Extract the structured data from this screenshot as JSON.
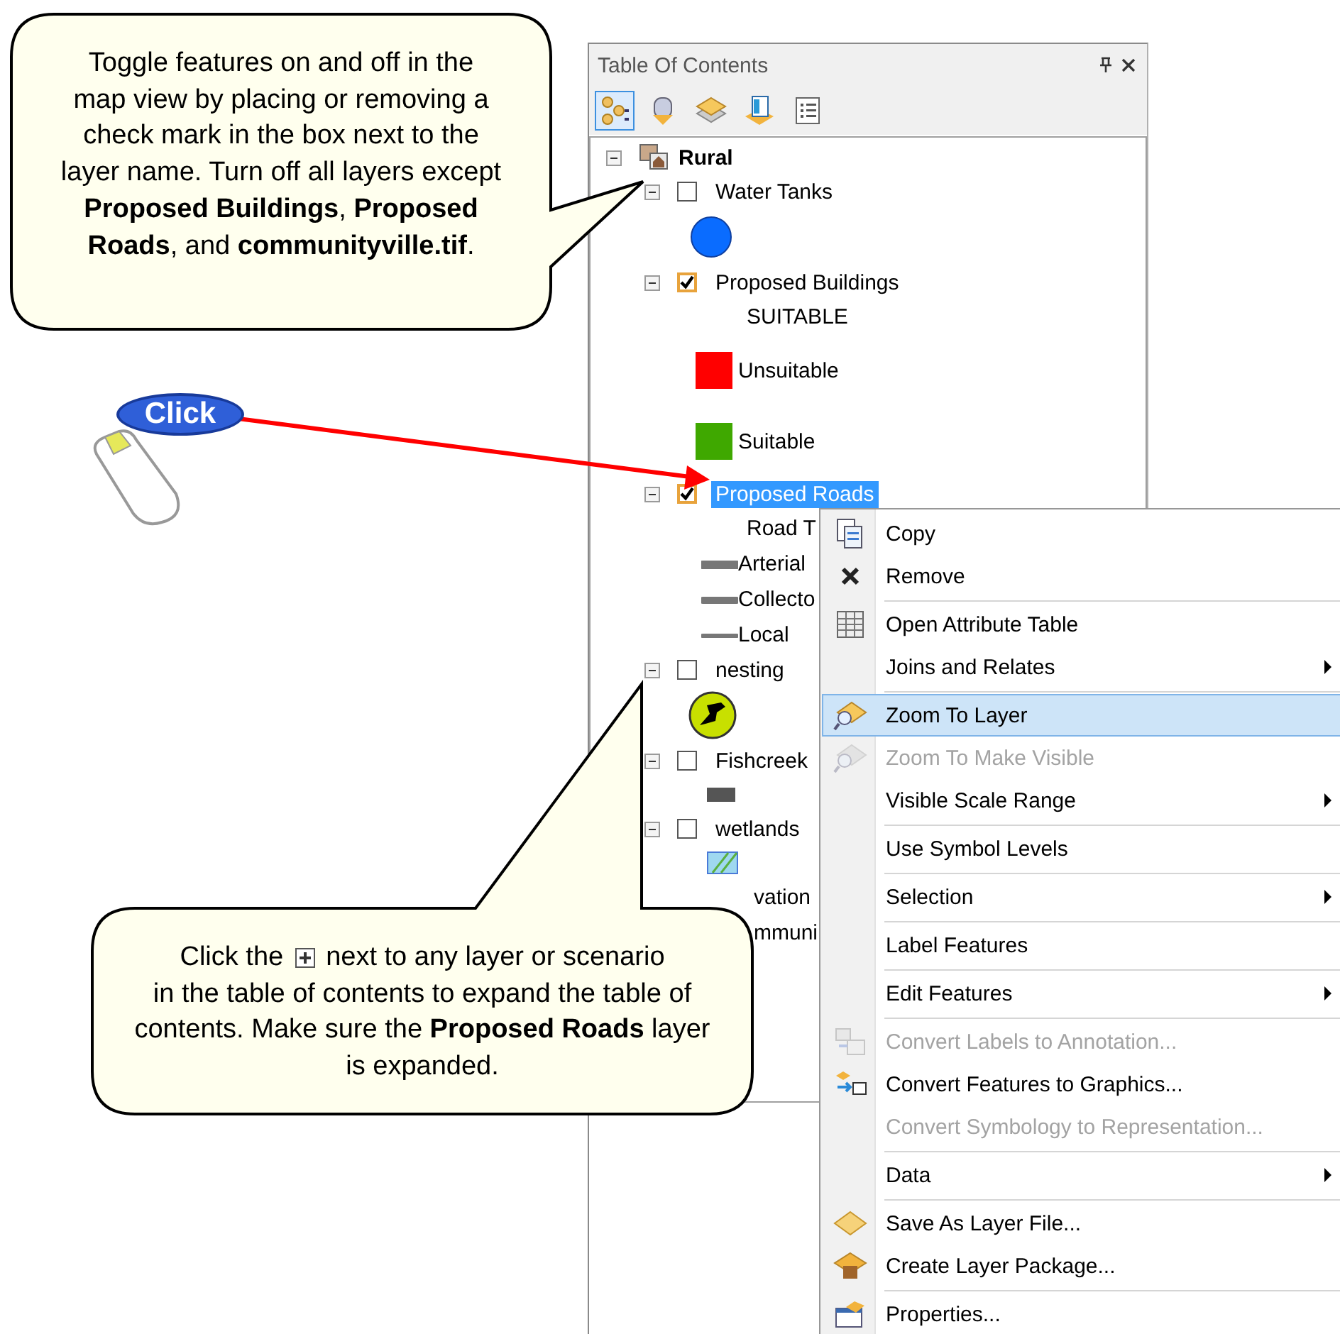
{
  "panel": {
    "title": "Table Of Contents",
    "toolbar": [
      {
        "kind": "drawing-order",
        "selected": true
      },
      {
        "kind": "source",
        "selected": false
      },
      {
        "kind": "visibility",
        "selected": false
      },
      {
        "kind": "selection",
        "selected": false
      },
      {
        "kind": "options",
        "selected": false
      }
    ]
  },
  "tree": {
    "name": "Rural",
    "expanded": true,
    "children": [
      {
        "kind": "layer",
        "name": "Water Tanks",
        "checked": false,
        "selected": false,
        "expanded": true,
        "legend": [
          {
            "kind": "circle",
            "color": "#0a6cff"
          }
        ]
      },
      {
        "kind": "layer",
        "name": "Proposed Buildings",
        "checked": true,
        "selected": false,
        "expanded": true,
        "legend": [
          {
            "kind": "heading",
            "label": "SUITABLE"
          },
          {
            "kind": "fill",
            "color": "#ff0000",
            "label": "Unsuitable"
          },
          {
            "kind": "fill",
            "color": "#3fa800",
            "label": "Suitable"
          }
        ]
      },
      {
        "kind": "layer",
        "name": "Proposed Roads",
        "checked": true,
        "selected": true,
        "expanded": true,
        "legend": [
          {
            "kind": "heading",
            "label": "Road T"
          },
          {
            "kind": "thickline",
            "label": "Arterial"
          },
          {
            "kind": "line",
            "label": "Collecto"
          },
          {
            "kind": "thinline",
            "label": "Local"
          }
        ]
      },
      {
        "kind": "layer",
        "name": "nesting",
        "checked": false,
        "selected": false,
        "expanded": true,
        "legend": [
          {
            "kind": "bird",
            "color": "#c8e000"
          }
        ]
      },
      {
        "kind": "layer",
        "name": "Fishcreek",
        "checked": false,
        "selected": false,
        "expanded": true,
        "legend": [
          {
            "kind": "bar",
            "color": "#555555"
          }
        ]
      },
      {
        "kind": "layer",
        "name": "wetlands",
        "checked": false,
        "selected": false,
        "expanded": true,
        "legend": [
          {
            "kind": "hatch",
            "color": "#9fd8f0"
          }
        ]
      },
      {
        "kind": "fragment",
        "name": "vation"
      },
      {
        "kind": "fragment",
        "name": "mmuni"
      }
    ]
  },
  "context_menu": [
    {
      "kind": "item",
      "label": "Copy",
      "disabled": false,
      "selected": false,
      "submenu": false
    },
    {
      "kind": "item",
      "label": "Remove",
      "disabled": false,
      "selected": false,
      "submenu": false
    },
    {
      "kind": "separator"
    },
    {
      "kind": "item",
      "label": "Open Attribute Table",
      "disabled": false,
      "selected": false,
      "submenu": false
    },
    {
      "kind": "item",
      "label": "Joins and Relates",
      "disabled": false,
      "selected": false,
      "submenu": true
    },
    {
      "kind": "separator"
    },
    {
      "kind": "item",
      "label": "Zoom To Layer",
      "disabled": false,
      "selected": true,
      "submenu": false
    },
    {
      "kind": "item",
      "label": "Zoom To Make Visible",
      "disabled": true,
      "selected": false,
      "submenu": false
    },
    {
      "kind": "item",
      "label": "Visible Scale Range",
      "disabled": false,
      "selected": false,
      "submenu": true
    },
    {
      "kind": "separator"
    },
    {
      "kind": "item",
      "label": "Use Symbol Levels",
      "disabled": false,
      "selected": false,
      "submenu": false
    },
    {
      "kind": "separator"
    },
    {
      "kind": "item",
      "label": "Selection",
      "disabled": false,
      "selected": false,
      "submenu": true
    },
    {
      "kind": "separator"
    },
    {
      "kind": "item",
      "label": "Label Features",
      "disabled": false,
      "selected": false,
      "submenu": false
    },
    {
      "kind": "separator"
    },
    {
      "kind": "item",
      "label": "Edit Features",
      "disabled": false,
      "selected": false,
      "submenu": true
    },
    {
      "kind": "separator"
    },
    {
      "kind": "item",
      "label": "Convert Labels to Annotation...",
      "disabled": true,
      "selected": false,
      "submenu": false
    },
    {
      "kind": "item",
      "label": "Convert Features to Graphics...",
      "disabled": false,
      "selected": false,
      "submenu": false
    },
    {
      "kind": "item",
      "label": "Convert Symbology to Representation...",
      "disabled": true,
      "selected": false,
      "submenu": false
    },
    {
      "kind": "separator"
    },
    {
      "kind": "item",
      "label": "Data",
      "disabled": false,
      "selected": false,
      "submenu": true
    },
    {
      "kind": "separator"
    },
    {
      "kind": "item",
      "label": "Save As Layer File...",
      "disabled": false,
      "selected": false,
      "submenu": false
    },
    {
      "kind": "item",
      "label": "Create Layer Package...",
      "disabled": false,
      "selected": false,
      "submenu": false
    },
    {
      "kind": "separator"
    },
    {
      "kind": "item",
      "label": "Properties...",
      "disabled": false,
      "selected": false,
      "submenu": false
    }
  ],
  "click_badge": {
    "text": "Click"
  },
  "callouts": [
    {
      "text": "Toggle features on and off in the map view by placing or removing a check mark in the box next to the layer name.  Turn off all layers except **Proposed Buildings**, **Proposed Roads**, and **communityville.tif**."
    },
    {
      "lead": "Click the",
      "after": "next to any layer or scenario",
      "text": "in the table of contents to expand the table of contents.  Make sure the **Proposed Roads** layer is expanded."
    }
  ]
}
